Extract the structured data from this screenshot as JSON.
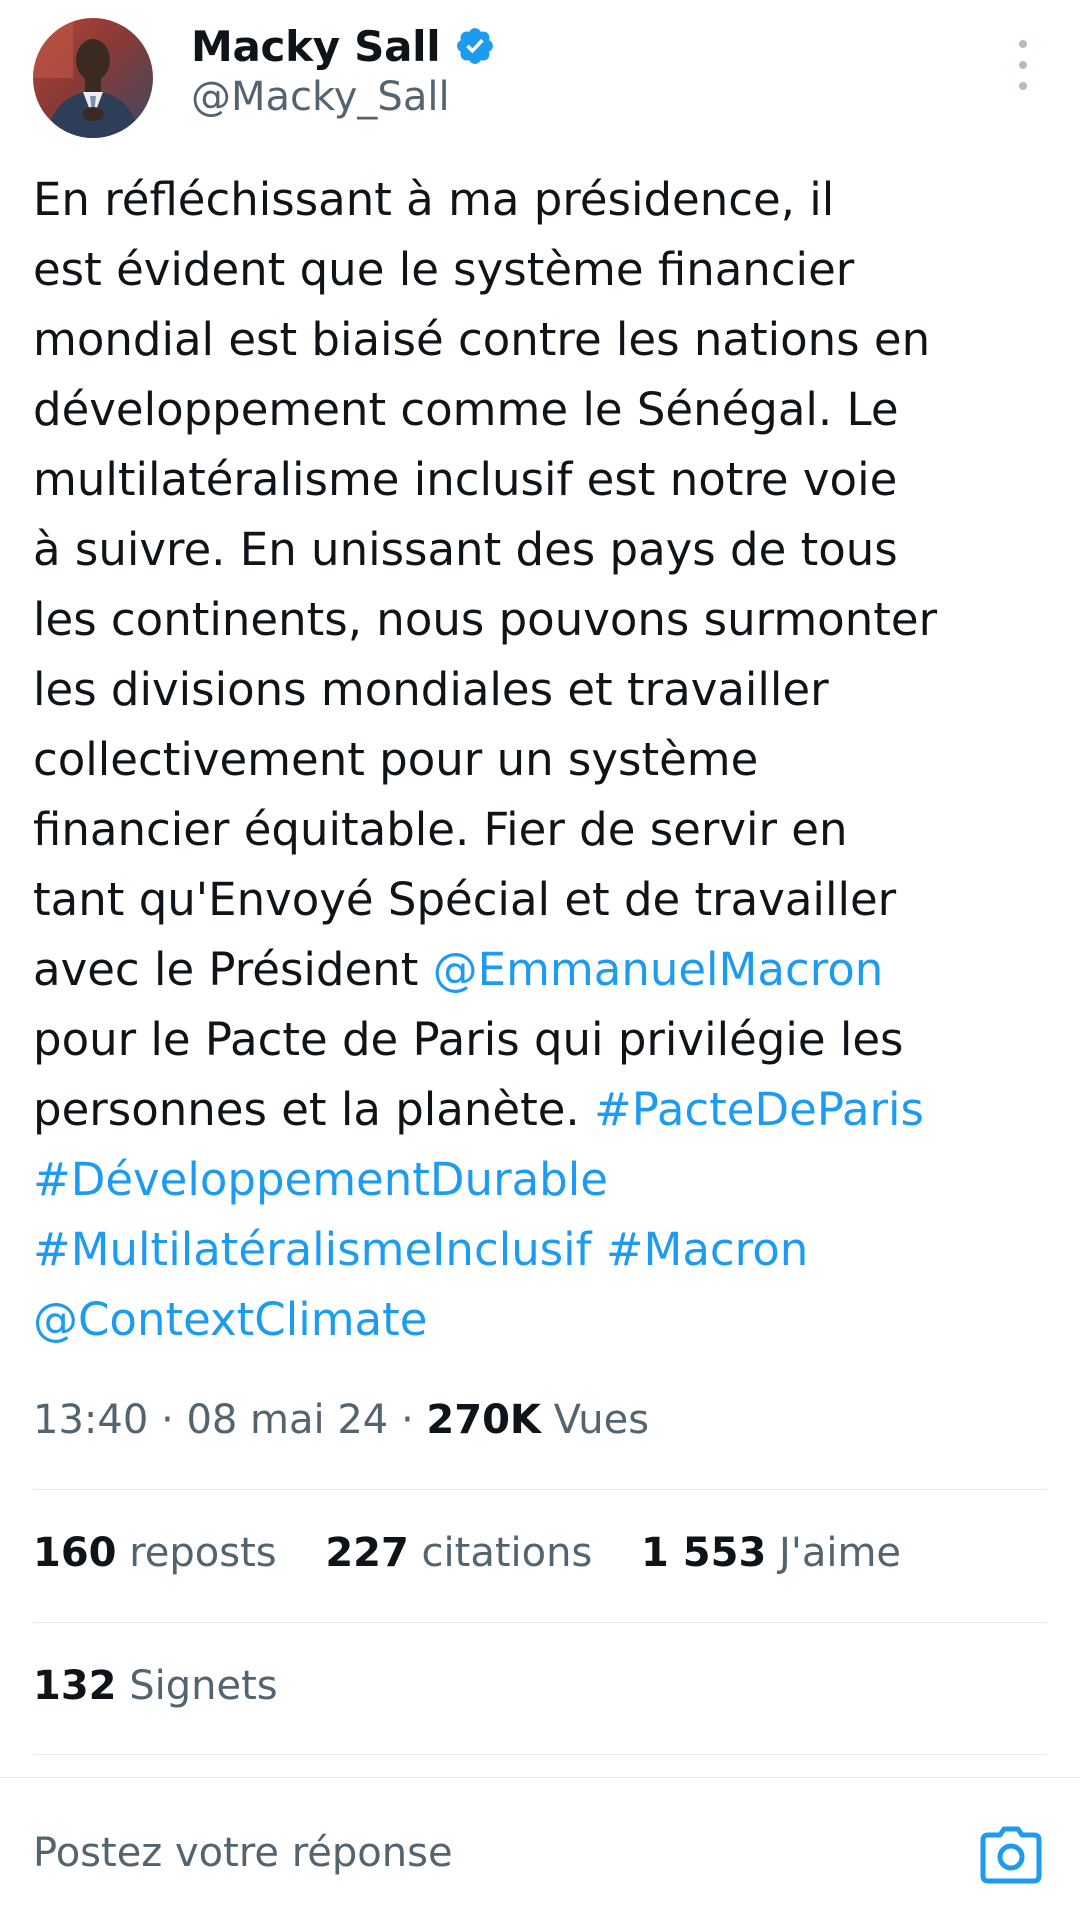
{
  "author": {
    "display_name": "Macky Sall",
    "handle": "@Macky_Sall",
    "verified": true
  },
  "tweet": {
    "lines": [
      [
        {
          "text": "En réfléchissant à ma présidence, il"
        }
      ],
      [
        {
          "text": "est évident que le système financier"
        }
      ],
      [
        {
          "text": "mondial est biaisé contre les nations en"
        }
      ],
      [
        {
          "text": "développement comme le Sénégal. Le"
        }
      ],
      [
        {
          "text": "multilatéralisme inclusif est notre voie"
        }
      ],
      [
        {
          "text": "à suivre. En unissant des pays de tous"
        }
      ],
      [
        {
          "text": "les continents, nous pouvons surmonter"
        }
      ],
      [
        {
          "text": "les divisions mondiales et travailler"
        }
      ],
      [
        {
          "text": "collectivement pour un système"
        }
      ],
      [
        {
          "text": "financier équitable. Fier de servir en"
        }
      ],
      [
        {
          "text": "tant qu'Envoyé Spécial et de travailler"
        }
      ],
      [
        {
          "text": "avec le Président "
        },
        {
          "text": "@EmmanuelMacron",
          "link": true
        }
      ],
      [
        {
          "text": "pour le Pacte de Paris qui privilégie les"
        }
      ],
      [
        {
          "text": "personnes et la planète. "
        },
        {
          "text": "#PacteDeParis",
          "link": true
        }
      ],
      [
        {
          "text": "#DéveloppementDurable",
          "link": true
        }
      ],
      [
        {
          "text": "#MultilatéralismeInclusif",
          "link": true
        },
        {
          "text": " "
        },
        {
          "text": "#Macron",
          "link": true
        }
      ],
      [
        {
          "text": "@ContextClimate",
          "link": true
        }
      ]
    ]
  },
  "meta": {
    "time": "13:40",
    "sep1": " · ",
    "date": "08 mai 24",
    "sep2": " · ",
    "views": "270K",
    "views_label": " Vues"
  },
  "stats": {
    "reposts_count": "160",
    "reposts_label": " reposts",
    "quotes_count": "227",
    "quotes_label": " citations",
    "likes_count": "1 553",
    "likes_label": " J'aime",
    "bookmarks_count": "132",
    "bookmarks_label": " Signets"
  },
  "reply": {
    "placeholder": "Postez votre réponse"
  },
  "icons": {
    "verified": "verified-badge-icon",
    "more": "more-vertical-icon",
    "camera": "camera-icon"
  },
  "colors": {
    "link": "#1d9bf0",
    "text": "#0f1419",
    "secondary": "#536471",
    "divider": "#e1e7ec"
  }
}
